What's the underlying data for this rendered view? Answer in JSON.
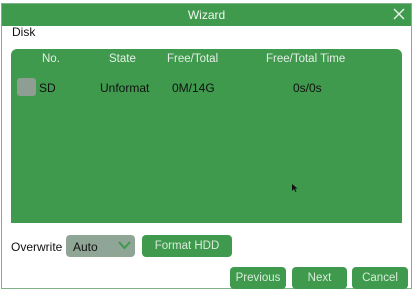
{
  "window": {
    "title": "Wizard"
  },
  "section": {
    "label": "Disk"
  },
  "table": {
    "columns": [
      "No.",
      "State",
      "Free/Total",
      "Free/Total Time"
    ],
    "rows": [
      {
        "no": "SD",
        "state": "Unformat",
        "free_total": "0M/14G",
        "free_total_time": "0s/0s"
      }
    ]
  },
  "overwrite": {
    "label": "Overwrite",
    "selected": "Auto"
  },
  "buttons": {
    "format": "Format HDD",
    "previous": "Previous",
    "next": "Next",
    "cancel": "Cancel"
  },
  "colors": {
    "accent": "#3f9a4d",
    "disabled_control": "#8fa696",
    "checkbox": "#8e9e92"
  },
  "icons": {
    "close": "close-icon",
    "dropdown": "chevron-down-icon",
    "cursor": "mouse-cursor-icon"
  }
}
